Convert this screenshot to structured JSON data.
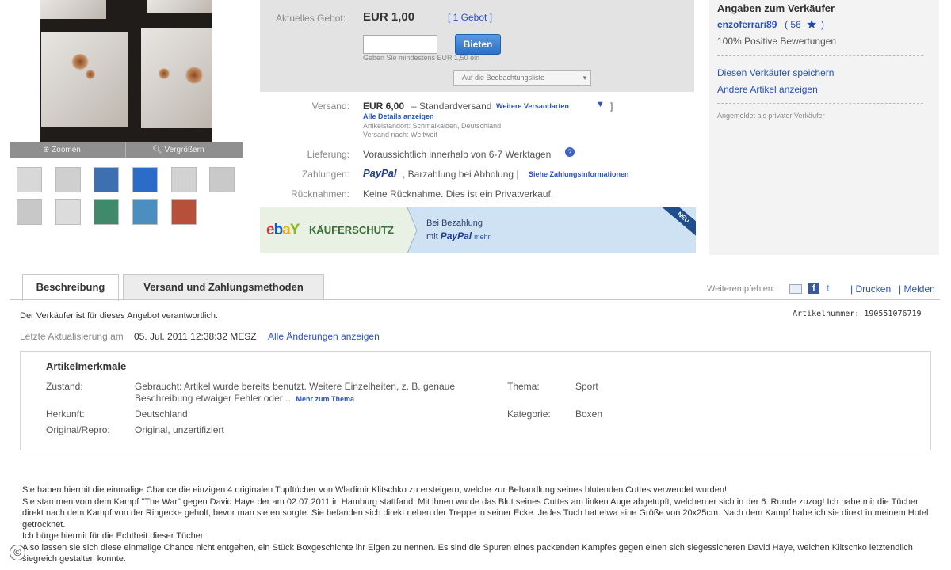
{
  "gallery": {
    "zoom_label": "Zoomen",
    "enlarge_label": "Vergrößern",
    "thumbnails": [
      {
        "color": "#d8d8d8"
      },
      {
        "color": "#cfcfcf"
      },
      {
        "color": "#3d6fb1"
      },
      {
        "color": "#2b6cc9"
      },
      {
        "color": "#d2d2d2"
      },
      {
        "color": "#c9c9c9"
      },
      {
        "color": "#c8c8c8"
      },
      {
        "color": "#dcdcdc"
      },
      {
        "color": "#3f8a6a"
      },
      {
        "color": "#4d8ec0"
      },
      {
        "color": "#b6503a"
      }
    ]
  },
  "bid": {
    "current_label": "Aktuelles Gebot:",
    "price": "EUR 1,00",
    "bid_count": "[ 1 Gebot ]",
    "button_label": "Bieten",
    "min_hint": "Geben Sie mindestens EUR 1,50 ein",
    "watchlist": "Auf die Beobachtungsliste"
  },
  "shipping": {
    "label": "Versand:",
    "price": "EUR 6,00",
    "method": "Standardversand",
    "more_link": "Weitere Versandarten",
    "details_link": "Alle Details anzeigen",
    "location": "Artikelstandort: Schmalkalden, Deutschland",
    "ships_to": "Versand nach: Weltweit"
  },
  "delivery": {
    "label": "Lieferung:",
    "value": "Voraussichtlich innerhalb von 6-7 Werktagen"
  },
  "payment": {
    "label": "Zahlungen:",
    "paypal": "PayPal",
    "value": ", Barzahlung bei Abholung |",
    "more_link": "Siehe Zahlungsinformationen"
  },
  "returns": {
    "label": "Rücknahmen:",
    "value": "Keine Rücknahme. Dies ist ein Privatverkauf."
  },
  "buyer_protection": {
    "logo_e": "e",
    "logo_b": "b",
    "logo_a": "a",
    "logo_y": "Y",
    "title": "KÄUFERSCHUTZ",
    "line1": "Bei Bezahlung",
    "line2_prefix": "mit",
    "paypal": "PayPal",
    "more": "mehr",
    "badge": "NEU"
  },
  "seller": {
    "heading": "Angaben zum Verkäufer",
    "name": "enzoferrari89",
    "score_open": "( 56",
    "score_close": ")",
    "positive": "100% Positive Bewertungen",
    "save_link": "Diesen Verkäufer speichern",
    "other_link": "Andere Artikel anzeigen",
    "private_note": "Angemeldet als privater Verkäufer"
  },
  "tabs": {
    "description": "Beschreibung",
    "shipping_payment": "Versand und Zahlungsmethoden",
    "recommend": "Weiterempfehlen:",
    "print": "| Drucken",
    "report": "| Melden"
  },
  "info": {
    "responsible": "Der Verkäufer ist für dieses Angebot verantwortlich.",
    "item_number_label": "Artikelnummer:",
    "item_number": "190551076719",
    "last_update_label": "Letzte Aktualisierung am",
    "last_update_value": "05. Jul. 2011 12:38:32 MESZ",
    "changes_link": "Alle Änderungen anzeigen"
  },
  "features": {
    "heading": "Artikelmerkmale",
    "condition_label": "Zustand:",
    "condition_value": "Gebraucht: Artikel wurde bereits benutzt. Weitere Einzelheiten, z. B. genaue Beschreibung etwaiger Fehler oder ...",
    "condition_more": "Mehr zum Thema",
    "origin_label": "Herkunft:",
    "origin_value": "Deutschland",
    "original_label": "Original/Repro:",
    "original_value": "Original, unzertifiziert",
    "theme_label": "Thema:",
    "theme_value": "Sport",
    "category_label": "Kategorie:",
    "category_value": "Boxen"
  },
  "description": {
    "lines": [
      " Sie haben hiermit die einmalige Chance die einzigen 4 originalen Tupftücher von Wladimir Klitschko zu ersteigern, welche zur Behandlung seines blutenden Cuttes verwendet wurden!",
      "Sie stammen vom dem Kampf \"The War\" gegen David Haye der am 02.07.2011 in Hamburg stattfand. Mit ihnen wurde das Blut seines Cuttes am linken Auge abgetupft, welchen er sich in der 6. Runde zuzog! Ich habe mir die Tücher direkt nach dem Kampf von der Ringecke geholt, bevor man sie entsorgte. Sie befanden sich direkt neben der Treppe in seiner Ecke. Jedes Tuch hat etwa eine Größe von 20x25cm. Nach dem Kampf habe ich sie direkt in meinem Hotel getrocknet.",
      "Ich bürge hiermit für die Echtheit dieser Tücher.",
      "Also lassen sie sich diese einmalige Chance nicht entgehen, ein Stück Boxgeschichte ihr Eigen zu nennen. Es sind die Spuren eines packenden Kampfes gegen einen sich siegessicheren David Haye, welchen Klitschko letztendlich siegreich gestalten konnte."
    ]
  },
  "footer": {
    "copyright_icon": "©"
  }
}
